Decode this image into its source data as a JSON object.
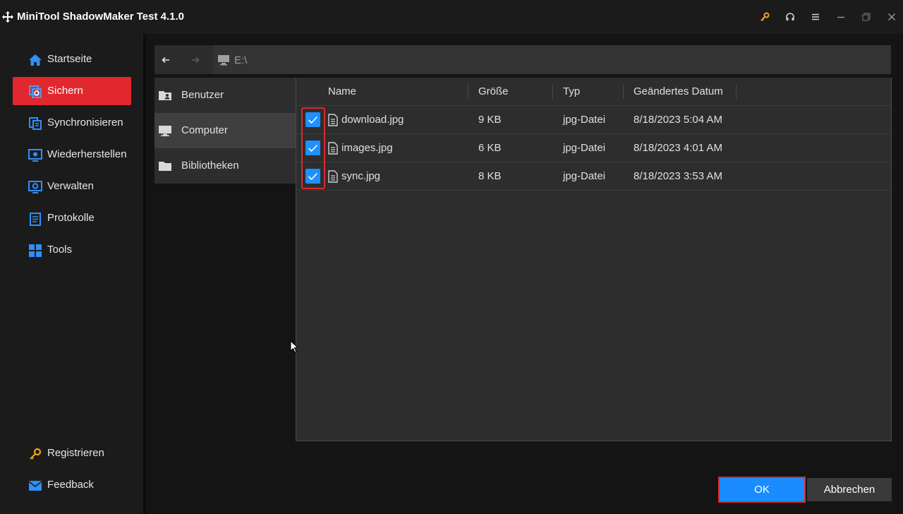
{
  "window": {
    "title": "MiniTool ShadowMaker Test 4.1.0",
    "controls": [
      "key-icon",
      "headset-icon",
      "menu-icon",
      "minimize-icon",
      "restore-icon",
      "close-icon"
    ]
  },
  "sidebar": {
    "items": [
      {
        "label": "Startseite",
        "icon": "home-icon"
      },
      {
        "label": "Sichern",
        "icon": "backup-icon",
        "active": true
      },
      {
        "label": "Synchronisieren",
        "icon": "sync-icon"
      },
      {
        "label": "Wiederherstellen",
        "icon": "restore-icon"
      },
      {
        "label": "Verwalten",
        "icon": "manage-icon"
      },
      {
        "label": "Protokolle",
        "icon": "log-icon"
      },
      {
        "label": "Tools",
        "icon": "tools-icon"
      }
    ],
    "bottom": [
      {
        "label": "Registrieren",
        "icon": "key-icon"
      },
      {
        "label": "Feedback",
        "icon": "mail-icon"
      }
    ]
  },
  "toolbar": {
    "path": "E:\\"
  },
  "tree": {
    "items": [
      {
        "label": "Benutzer",
        "icon": "user-folder-icon"
      },
      {
        "label": "Computer",
        "icon": "computer-icon",
        "selected": true
      },
      {
        "label": "Bibliotheken",
        "icon": "folder-icon"
      }
    ]
  },
  "files": {
    "columns": [
      "Name",
      "Größe",
      "Typ",
      "Geändertes Datum"
    ],
    "rows": [
      {
        "name": "download.jpg",
        "size": "9 KB",
        "type": "jpg-Datei",
        "date": "8/18/2023 5:04 AM",
        "checked": true
      },
      {
        "name": "images.jpg",
        "size": "6 KB",
        "type": "jpg-Datei",
        "date": "8/18/2023 4:01 AM",
        "checked": true
      },
      {
        "name": "sync.jpg",
        "size": "8 KB",
        "type": "jpg-Datei",
        "date": "8/18/2023 3:53 AM",
        "checked": true
      }
    ]
  },
  "buttons": {
    "ok": "OK",
    "cancel": "Abbrechen"
  },
  "colors": {
    "accent_red": "#e0282e",
    "accent_blue": "#1a8cff"
  }
}
